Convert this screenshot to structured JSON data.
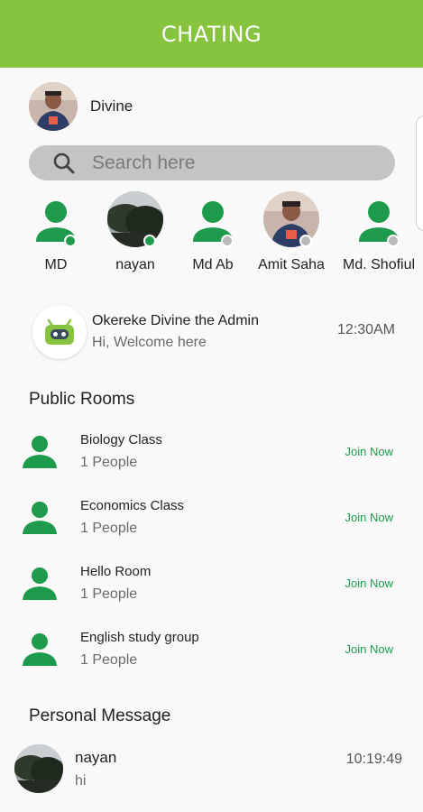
{
  "appbar": {
    "title": "CHATING"
  },
  "me": {
    "name": "Divine"
  },
  "search": {
    "placeholder": "Search here"
  },
  "contacts": [
    {
      "name": "MD",
      "avatar": "person-icon",
      "status": "online"
    },
    {
      "name": "nayan",
      "avatar": "photo-tree",
      "status": "online"
    },
    {
      "name": "Md Ab",
      "avatar": "person-icon",
      "status": "offline"
    },
    {
      "name": "Amit Saha",
      "avatar": "photo-person",
      "status": "offline"
    },
    {
      "name": "Md. Shofiul",
      "avatar": "person-icon",
      "status": "offline"
    }
  ],
  "admin": {
    "title": "Okereke Divine the Admin",
    "message": "Hi, Welcome here",
    "time": "12:30AM"
  },
  "public_rooms": {
    "title": "Public Rooms",
    "items": [
      {
        "name": "Biology Class",
        "count": "1 People",
        "action": "Join Now"
      },
      {
        "name": "Economics Class",
        "count": "1 People",
        "action": "Join Now"
      },
      {
        "name": "Hello Room",
        "count": "1 People",
        "action": "Join Now"
      },
      {
        "name": "English study group",
        "count": "1 People",
        "action": "Join Now"
      }
    ]
  },
  "personal": {
    "title": "Personal Message",
    "items": [
      {
        "name": "nayan",
        "message": "hi",
        "time": "10:19:49"
      }
    ]
  },
  "colors": {
    "appbar": "#86c440",
    "accent_green": "#1e9a4c",
    "offline": "#b9b9b9",
    "search_bg": "#c4c4c4"
  }
}
